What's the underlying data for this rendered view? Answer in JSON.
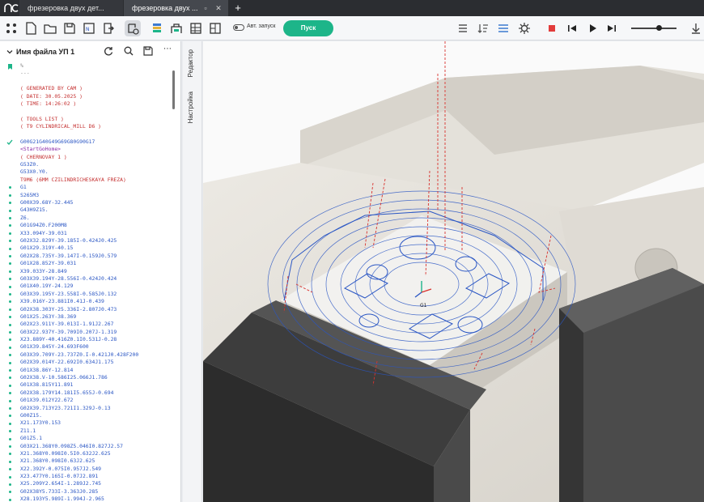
{
  "tabs": [
    {
      "label": "фрезеровка двух дет..."
    },
    {
      "label": "фрезеровка двух ..."
    }
  ],
  "toolbar": {
    "autostart_label": "Авт. запуск",
    "run_label": "Пуск",
    "speed_level": 0.6
  },
  "file_panel": {
    "title": "Имя файла УП 1"
  },
  "side_tabs": [
    "Редактор",
    "Настройка"
  ],
  "code": {
    "lines": [
      {
        "t": "%",
        "c": "grey"
      },
      {
        "t": "---",
        "c": "grey"
      },
      {
        "t": "",
        "c": "grey"
      },
      {
        "t": "( GENERATED BY CAM )",
        "c": "red"
      },
      {
        "t": "( DATE: 30.05.2025 )",
        "c": "red"
      },
      {
        "t": "( TIME: 14:26:02 )",
        "c": "red"
      },
      {
        "t": "",
        "c": "grey"
      },
      {
        "t": "( TOOLS LIST )",
        "c": "red"
      },
      {
        "t": "( T9 CYLINDRICAL_MILL D6 )",
        "c": "red"
      },
      {
        "t": "",
        "c": "grey"
      },
      {
        "t": "G00G21G40G49G69G80G90G17",
        "c": "blue"
      },
      {
        "t": "<StartGoHome>",
        "c": "purple"
      },
      {
        "t": "( CHERNOVAY 1 )",
        "c": "red"
      },
      {
        "t": "G53Z0.",
        "c": "blue"
      },
      {
        "t": "G53X0.Y0.",
        "c": "blue"
      },
      {
        "t": "T9M6 (6MM CZILINDRICHESKAYA FREZA)",
        "c": "red"
      },
      {
        "t": "G1",
        "c": "blue"
      },
      {
        "t": "S265M3",
        "c": "blue"
      },
      {
        "t": "G00X39.68Y-32.445",
        "c": "blue"
      },
      {
        "t": "G43H9Z15.",
        "c": "blue"
      },
      {
        "t": "Z6.",
        "c": "blue"
      },
      {
        "t": "G01G94Z0.F200M8",
        "c": "blue"
      },
      {
        "t": "X33.094Y-39.031",
        "c": "blue"
      },
      {
        "t": "G02X32.829Y-39.185I-0.424J0.425",
        "c": "blue"
      },
      {
        "t": "G01X29.319Y-40.15",
        "c": "blue"
      },
      {
        "t": "G02X28.735Y-39.147I-0.159J0.579",
        "c": "blue"
      },
      {
        "t": "G01X28.852Y-39.031",
        "c": "blue"
      },
      {
        "t": "X39.033Y-28.849",
        "c": "blue"
      },
      {
        "t": "G03X39.194Y-28.556I-0.424J0.424",
        "c": "blue"
      },
      {
        "t": "G01X40.19Y-24.129",
        "c": "blue"
      },
      {
        "t": "G03X39.195Y-23.558I-0.585J0.132",
        "c": "blue"
      },
      {
        "t": "X39.016Y-23.881I0.41J-0.439",
        "c": "blue"
      },
      {
        "t": "G02X38.303Y-25.336I-2.807J0.473",
        "c": "blue"
      },
      {
        "t": "G01X25.263Y-38.369",
        "c": "blue"
      },
      {
        "t": "G02X23.911Y-39.013I-1.91J2.267",
        "c": "blue"
      },
      {
        "t": "G03X22.937Y-39.709I0.207J-1.319",
        "c": "blue"
      },
      {
        "t": "X23.889Y-40.416Z0.1I0.531J-0.28",
        "c": "blue"
      },
      {
        "t": "G01X39.845Y-24.693F600",
        "c": "blue"
      },
      {
        "t": "G03X39.709Y-23.737Z0.I-0.421J0.428F200",
        "c": "blue"
      },
      {
        "t": "G02X39.014Y-22.692I0.634J1.175",
        "c": "blue"
      },
      {
        "t": "G01X38.86Y-12.814",
        "c": "blue"
      },
      {
        "t": "G02X38.V-10.586I25.066J1.786",
        "c": "blue"
      },
      {
        "t": "G01X38.815Y11.891",
        "c": "blue"
      },
      {
        "t": "G02X38.179Y14.181I5.655J-0.694",
        "c": "blue"
      },
      {
        "t": "G01X39.012Y22.672",
        "c": "blue"
      },
      {
        "t": "G02X39.713Y23.721I1.329J-0.13",
        "c": "blue"
      },
      {
        "t": "G00Z15.",
        "c": "blue"
      },
      {
        "t": "X21.173Y0.153",
        "c": "blue"
      },
      {
        "t": "Z11.1",
        "c": "blue"
      },
      {
        "t": "G01Z5.1",
        "c": "blue"
      },
      {
        "t": "G03X21.368Y0.098Z5.046I0.827J2.57",
        "c": "blue"
      },
      {
        "t": "X21.368Y0.098I0.5I0.632J2.625",
        "c": "blue"
      },
      {
        "t": "X21.368Y0.098I0.63J2.625",
        "c": "blue"
      },
      {
        "t": "X22.392Y-0.075I0.957J2.549",
        "c": "blue"
      },
      {
        "t": "X23.477Y0.165I-0.07J2.891",
        "c": "blue"
      },
      {
        "t": "X25.209Y2.654I-1.289J2.745",
        "c": "blue"
      },
      {
        "t": "G02X38Y5.733I-3.363J0.285",
        "c": "blue"
      },
      {
        "t": "X28.193Y5.989I-1.994J-2.965",
        "c": "blue"
      }
    ]
  }
}
